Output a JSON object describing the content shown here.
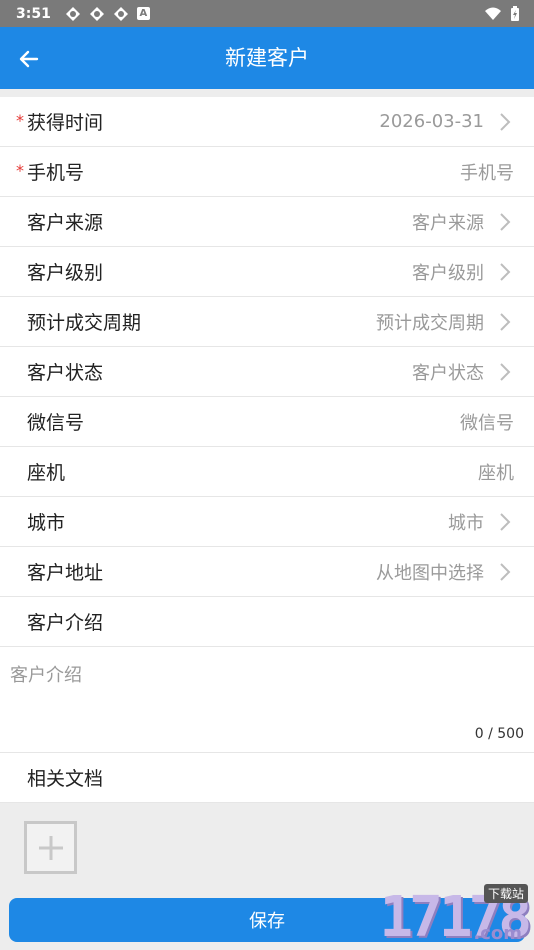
{
  "status_bar": {
    "time": "3:51"
  },
  "app_bar": {
    "title": "新建客户"
  },
  "form": {
    "rows": [
      {
        "label": "获得时间",
        "value": "2026-03-31",
        "required": true
      },
      {
        "label": "手机号",
        "value": "手机号",
        "required": true
      },
      {
        "label": "客户来源",
        "value": "客户来源"
      },
      {
        "label": "客户级别",
        "value": "客户级别"
      },
      {
        "label": "预计成交周期",
        "value": "预计成交周期"
      },
      {
        "label": "客户状态",
        "value": "客户状态"
      },
      {
        "label": "微信号",
        "value": "微信号"
      },
      {
        "label": "座机",
        "value": "座机"
      },
      {
        "label": "城市",
        "value": "城市"
      },
      {
        "label": "客户地址",
        "value": "从地图中选择"
      },
      {
        "label": "客户介绍"
      }
    ],
    "intro": {
      "placeholder": "客户介绍",
      "counter": "0 / 500"
    },
    "docs_label": "相关文档"
  },
  "save_label": "保存",
  "watermark": {
    "number": "17178",
    "tag": "下载站",
    "suffix": ".com"
  },
  "colors": {
    "primary": "#1e88e5",
    "required": "#e53935",
    "status_bar": "#7a7a7a"
  }
}
